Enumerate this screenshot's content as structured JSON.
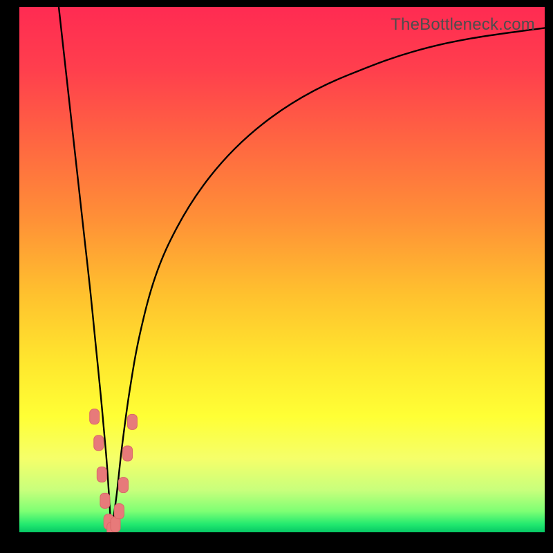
{
  "watermark": "TheBottleneck.com",
  "colors": {
    "frame": "#000000",
    "curve": "#000000",
    "marker_fill": "#e77a7a",
    "marker_stroke": "#d96868",
    "gradient_stops": [
      {
        "offset": 0.0,
        "color": "#ff2b52"
      },
      {
        "offset": 0.12,
        "color": "#ff3f4d"
      },
      {
        "offset": 0.25,
        "color": "#ff6442"
      },
      {
        "offset": 0.4,
        "color": "#ff8f37"
      },
      {
        "offset": 0.55,
        "color": "#ffc22e"
      },
      {
        "offset": 0.68,
        "color": "#ffe82e"
      },
      {
        "offset": 0.78,
        "color": "#ffff35"
      },
      {
        "offset": 0.86,
        "color": "#f5ff6a"
      },
      {
        "offset": 0.92,
        "color": "#c8ff7c"
      },
      {
        "offset": 0.96,
        "color": "#7eff74"
      },
      {
        "offset": 0.985,
        "color": "#22e96f"
      },
      {
        "offset": 1.0,
        "color": "#06c765"
      }
    ]
  },
  "chart_data": {
    "type": "line",
    "title": "",
    "xlabel": "",
    "ylabel": "",
    "xlim": [
      0,
      100
    ],
    "ylim": [
      0,
      100
    ],
    "grid": false,
    "series": [
      {
        "name": "left-branch",
        "x": [
          7.5,
          8.5,
          9.5,
          10.5,
          11.5,
          12.5,
          13.5,
          14.5,
          15.5,
          16.5,
          17.0,
          17.5
        ],
        "y": [
          100,
          91,
          82,
          73,
          64,
          55,
          46,
          36,
          26,
          15,
          8,
          0
        ]
      },
      {
        "name": "right-branch",
        "x": [
          17.5,
          18.5,
          19.5,
          21,
          23,
          26,
          30,
          35,
          41,
          48,
          56,
          65,
          75,
          86,
          100
        ],
        "y": [
          0,
          7,
          16,
          27,
          38,
          49,
          58,
          66,
          73,
          79,
          84,
          88,
          91.5,
          94,
          96
        ]
      }
    ],
    "markers": {
      "name": "highlight-points",
      "comment": "rounded-rect salmon markers near the valley",
      "points": [
        {
          "x": 14.3,
          "y": 22
        },
        {
          "x": 15.1,
          "y": 17
        },
        {
          "x": 15.7,
          "y": 11
        },
        {
          "x": 16.3,
          "y": 6
        },
        {
          "x": 17.0,
          "y": 2
        },
        {
          "x": 17.6,
          "y": 0.5
        },
        {
          "x": 18.3,
          "y": 1.5
        },
        {
          "x": 19.0,
          "y": 4
        },
        {
          "x": 19.8,
          "y": 9
        },
        {
          "x": 20.6,
          "y": 15
        },
        {
          "x": 21.5,
          "y": 21
        }
      ]
    }
  }
}
